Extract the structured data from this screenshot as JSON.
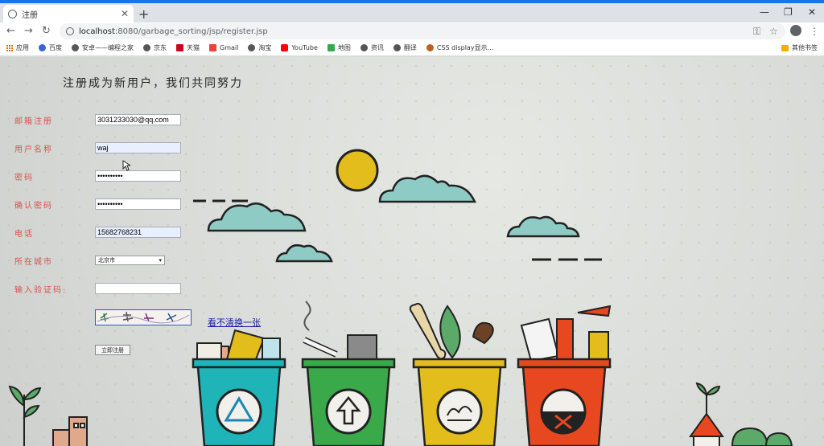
{
  "browser": {
    "tab_title": "注册",
    "url_host": "localhost",
    "url_path": ":8080/garbage_sorting/jsp/register.jsp",
    "bookmarks": [
      "应用",
      "百度",
      "安卓——编程之家",
      "京东",
      "天猫",
      "Gmail",
      "淘宝",
      "YouTube",
      "地图",
      "资讯",
      "翻译",
      "CSS display显示..."
    ],
    "bookmarks_right": "其他书签"
  },
  "page": {
    "heading": "注册成为新用户，我们共同努力",
    "fields": [
      {
        "label": "邮箱注册",
        "value": "3031233030@qq.com"
      },
      {
        "label": "用户名称",
        "value": "waj"
      },
      {
        "label": "密码",
        "value": "••••••••••"
      },
      {
        "label": "确认密码",
        "value": "••••••••••"
      },
      {
        "label": "电话",
        "value": "15682768231"
      },
      {
        "label": "所在城市",
        "value": "北京市"
      },
      {
        "label": "输入验证码:",
        "value": ""
      }
    ],
    "captcha_link": "看不清换一张",
    "submit": "立即注册"
  },
  "colors": {
    "accent": "#1a73e8",
    "label": "#d9534f",
    "bin_teal": "#1fb5b8",
    "bin_green": "#3aa94a",
    "bin_yellow": "#e2bd1c",
    "bin_red": "#e8481f"
  }
}
